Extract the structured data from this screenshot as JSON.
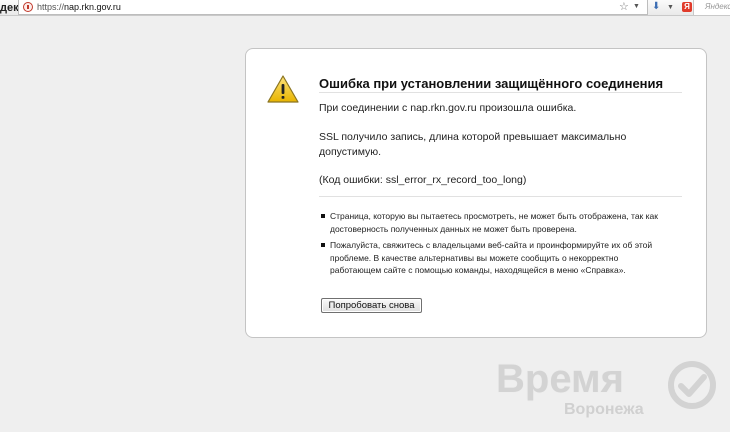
{
  "browser": {
    "brand_partial": "декс",
    "url_scheme": "https://",
    "url_host": "nap.rkn.gov.ru",
    "search_placeholder": "Яндекс",
    "yandex_logo_letter": "Я"
  },
  "error": {
    "title": "Ошибка при установлении защищённого соединения",
    "description": "При соединении с nap.rkn.gov.ru произошла ошибка.",
    "ssl_message": "SSL получило запись, длина которой превышает максимально допустимую.",
    "error_code": "(Код ошибки: ssl_error_rx_record_too_long)",
    "bullets": [
      "Страница, которую вы пытаетесь просмотреть, не может быть отображена, так как достоверность полученных данных не может быть проверена.",
      "Пожалуйста, свяжитесь с владельцами веб-сайта и проинформируйте их об этой проблеме. В качестве альтернативы вы можете сообщить о некорректно работающем сайте с помощью команды, находящейся в меню «Справка»."
    ],
    "retry_label": "Попробовать снова"
  },
  "watermark": {
    "title": "Время",
    "subtitle": "Воронежа"
  },
  "colors": {
    "page_background": "#efefef",
    "warning_yellow": "#f5c518",
    "watermark_gray": "#d3d3d3"
  },
  "icons": {
    "url": "security-warning-icon",
    "warning": "warning-triangle-icon",
    "star": "star-icon",
    "bookmark": "download-arrow-icon",
    "watermark": "checkmark-circle-icon"
  }
}
